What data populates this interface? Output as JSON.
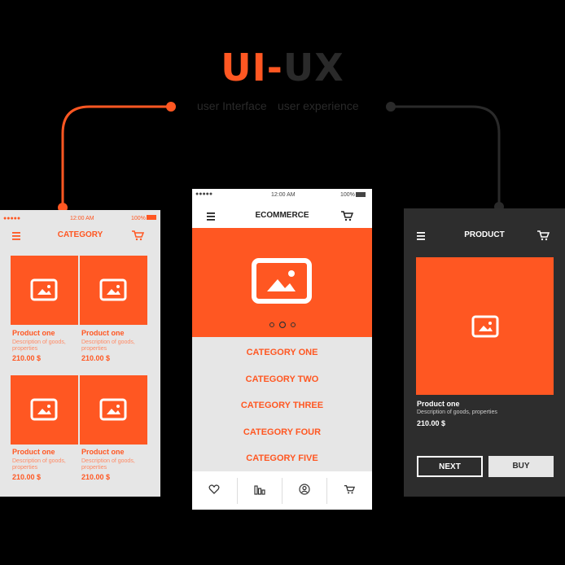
{
  "header": {
    "title_ui": "UI",
    "title_dash": "-",
    "title_ux": "UX",
    "left_caption": "user Interface",
    "right_caption": "user experience"
  },
  "colors": {
    "accent": "#ff5722",
    "dark": "#2d2d2d",
    "light": "#e6e6e6"
  },
  "category_screen": {
    "time": "12:00 AM",
    "battery": "100%",
    "title": "CATEGORY",
    "products": [
      {
        "name": "Product one",
        "desc": "Description of goods,",
        "desc2": "properties",
        "price": "210.00 $"
      },
      {
        "name": "Product one",
        "desc": "Description of goods,",
        "desc2": "properties",
        "price": "210.00 $"
      },
      {
        "name": "Product one",
        "desc": "Description of goods,",
        "desc2": "properties",
        "price": "210.00 $"
      },
      {
        "name": "Product one",
        "desc": "Description of goods,",
        "desc2": "properties",
        "price": "210.00 $"
      }
    ]
  },
  "ecommerce_screen": {
    "signal": "●●●●●",
    "time": "12:00 AM",
    "battery": "100%",
    "title": "ECOMMERCE",
    "categories": [
      "CATEGORY ONE",
      "CATEGORY TWO",
      "CATEGORY THREE",
      "CATEGORY FOUR",
      "CATEGORY FIVE"
    ],
    "tabs": [
      "heart-icon",
      "chart-icon",
      "profile-icon",
      "cart-icon"
    ]
  },
  "product_screen": {
    "title": "PRODUCT",
    "name": "Product one",
    "desc": "Description of goods, properties",
    "price": "210.00 $",
    "next_label": "NEXT",
    "buy_label": "BUY"
  }
}
